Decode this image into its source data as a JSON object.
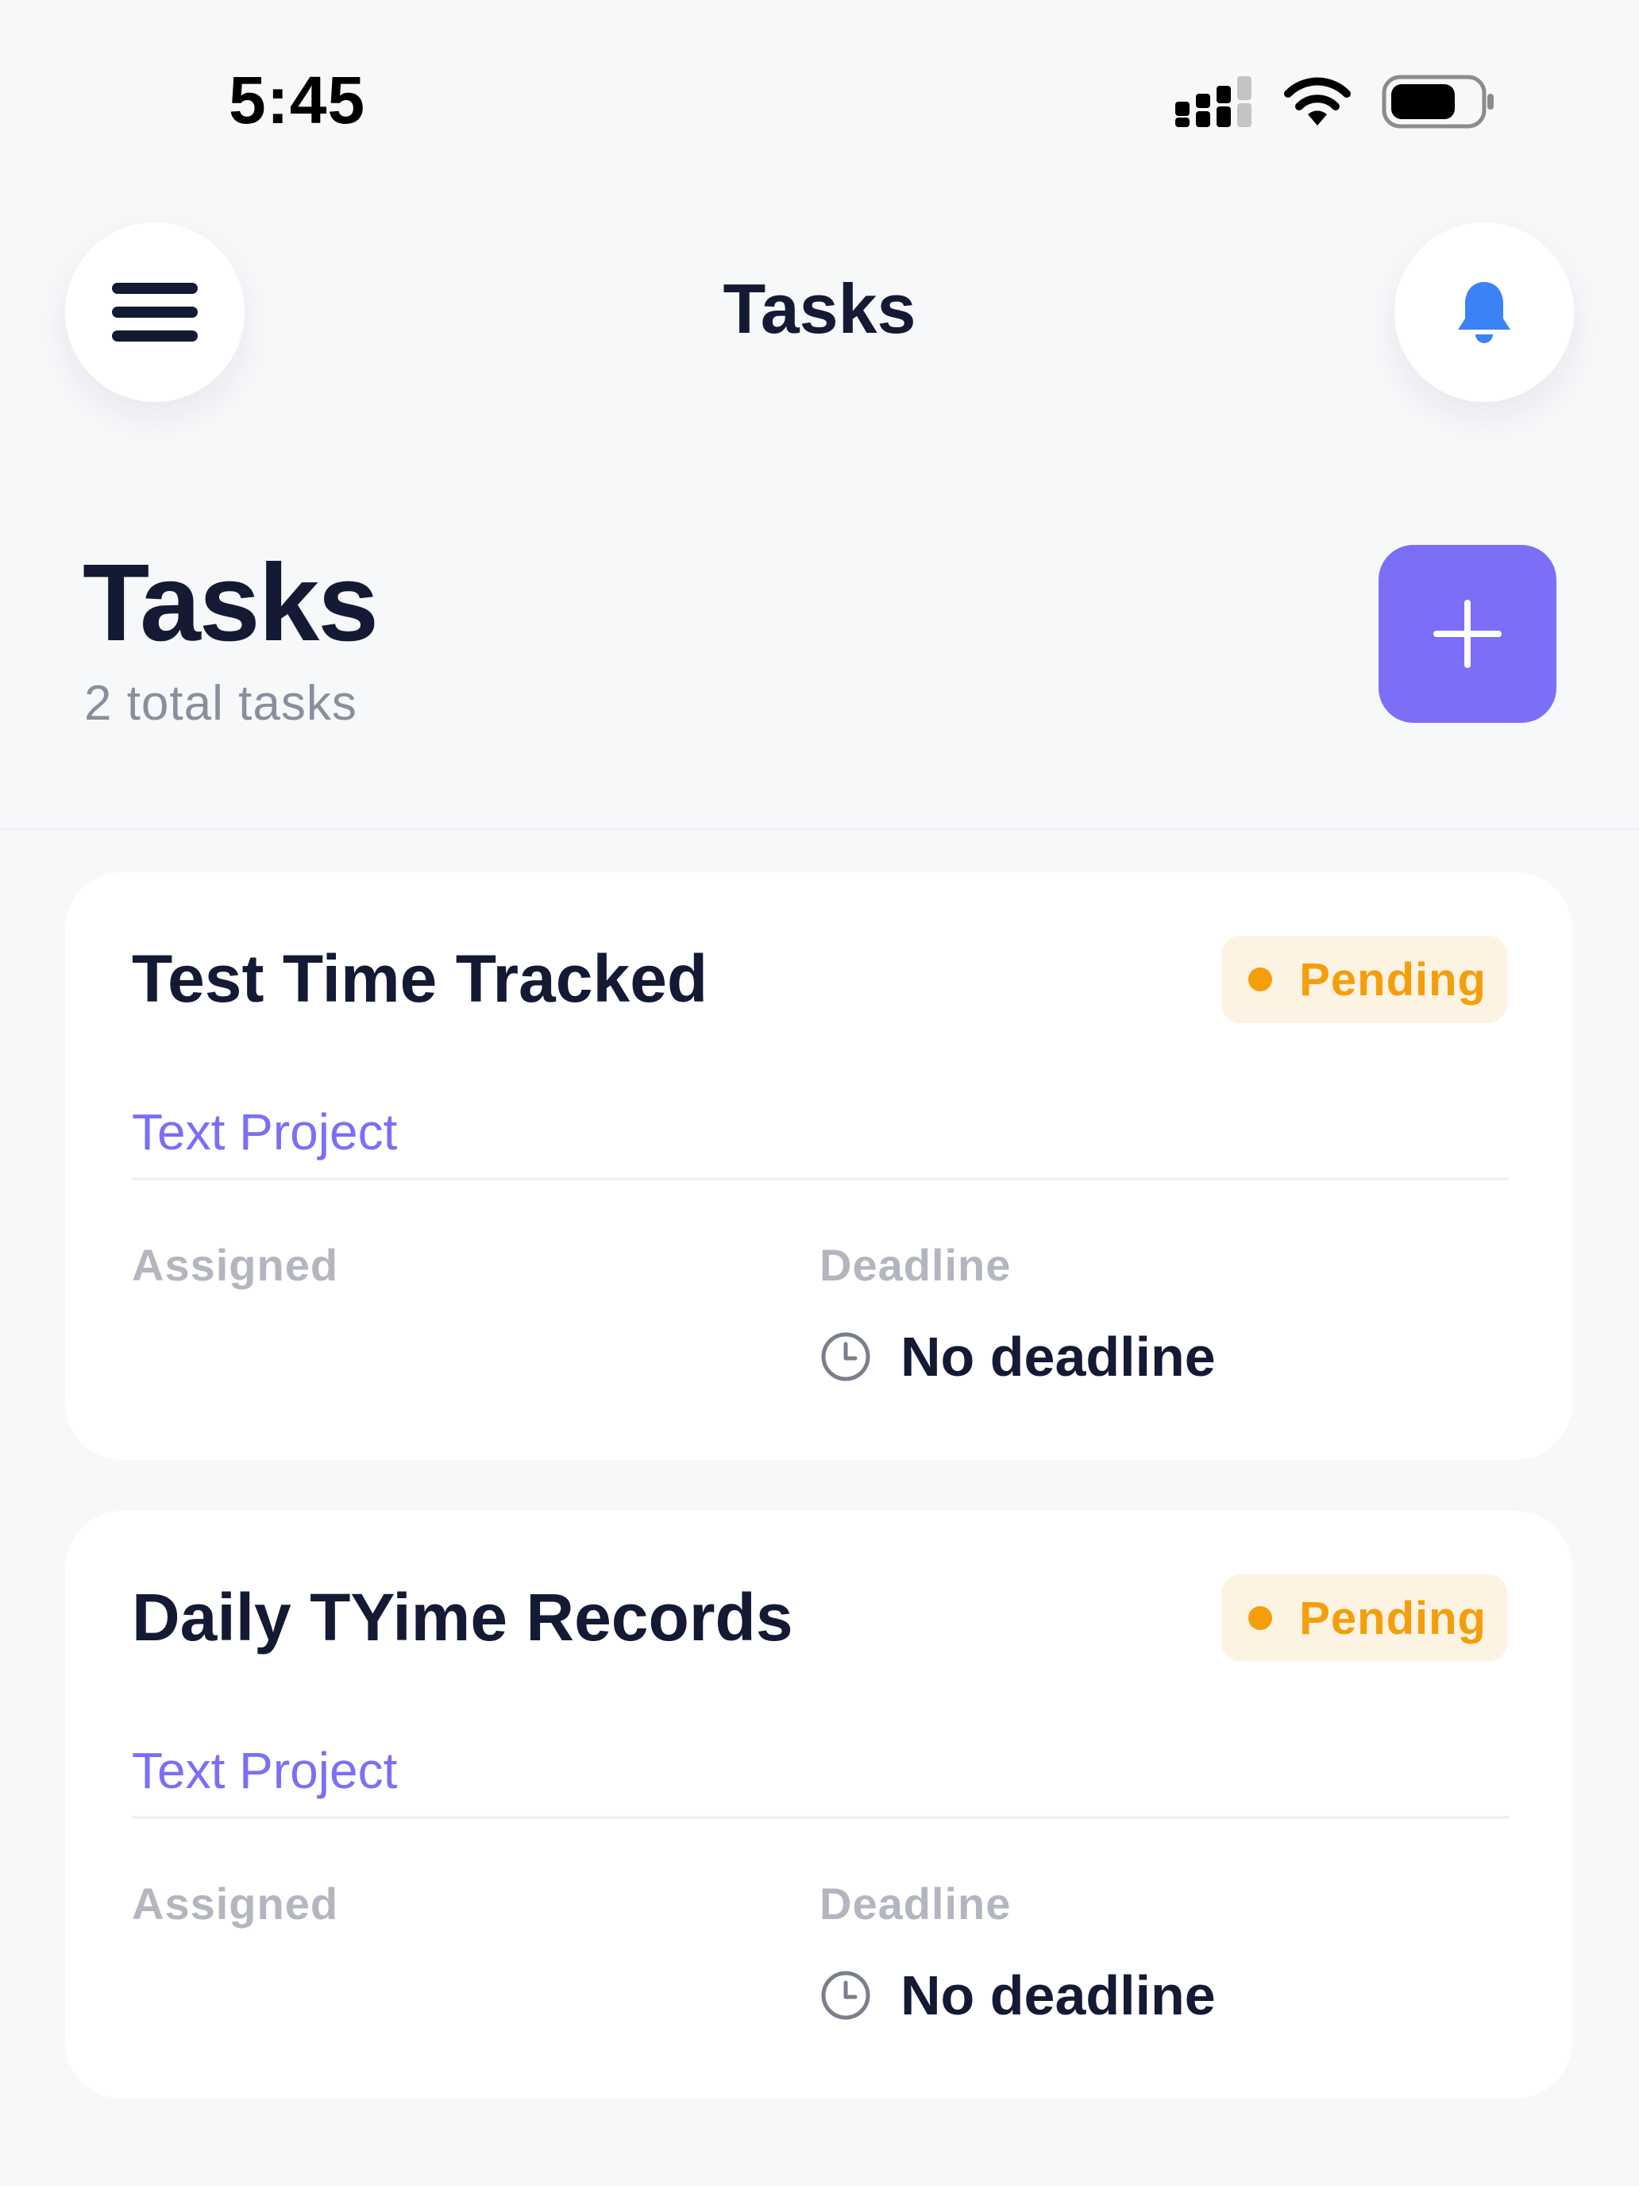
{
  "status_bar": {
    "time": "5:45",
    "icons": [
      "signal-icon",
      "wifi-icon",
      "battery-icon"
    ]
  },
  "nav": {
    "title": "Tasks",
    "menu_icon": "hamburger-menu-icon",
    "bell_icon": "bell-icon"
  },
  "header": {
    "title": "Tasks",
    "subtitle": "2 total tasks",
    "add_icon": "plus-icon"
  },
  "colors": {
    "accent": "#7b6ff7",
    "bell": "#3b82f6",
    "pending": "#f59e0b",
    "pending_bg": "#fdf3e2",
    "text_primary": "#141a33",
    "text_muted": "#8a8f9c",
    "label_muted": "#b3b6bf",
    "background": "#f7f8fa"
  },
  "tasks": [
    {
      "title": "Test Time Tracked",
      "status": "Pending",
      "project": "Text Project",
      "assigned_label": "Assigned",
      "deadline_label": "Deadline",
      "deadline_value": "No deadline"
    },
    {
      "title": "Daily TYime Records",
      "status": "Pending",
      "project": "Text Project",
      "assigned_label": "Assigned",
      "deadline_label": "Deadline",
      "deadline_value": "No deadline"
    }
  ]
}
